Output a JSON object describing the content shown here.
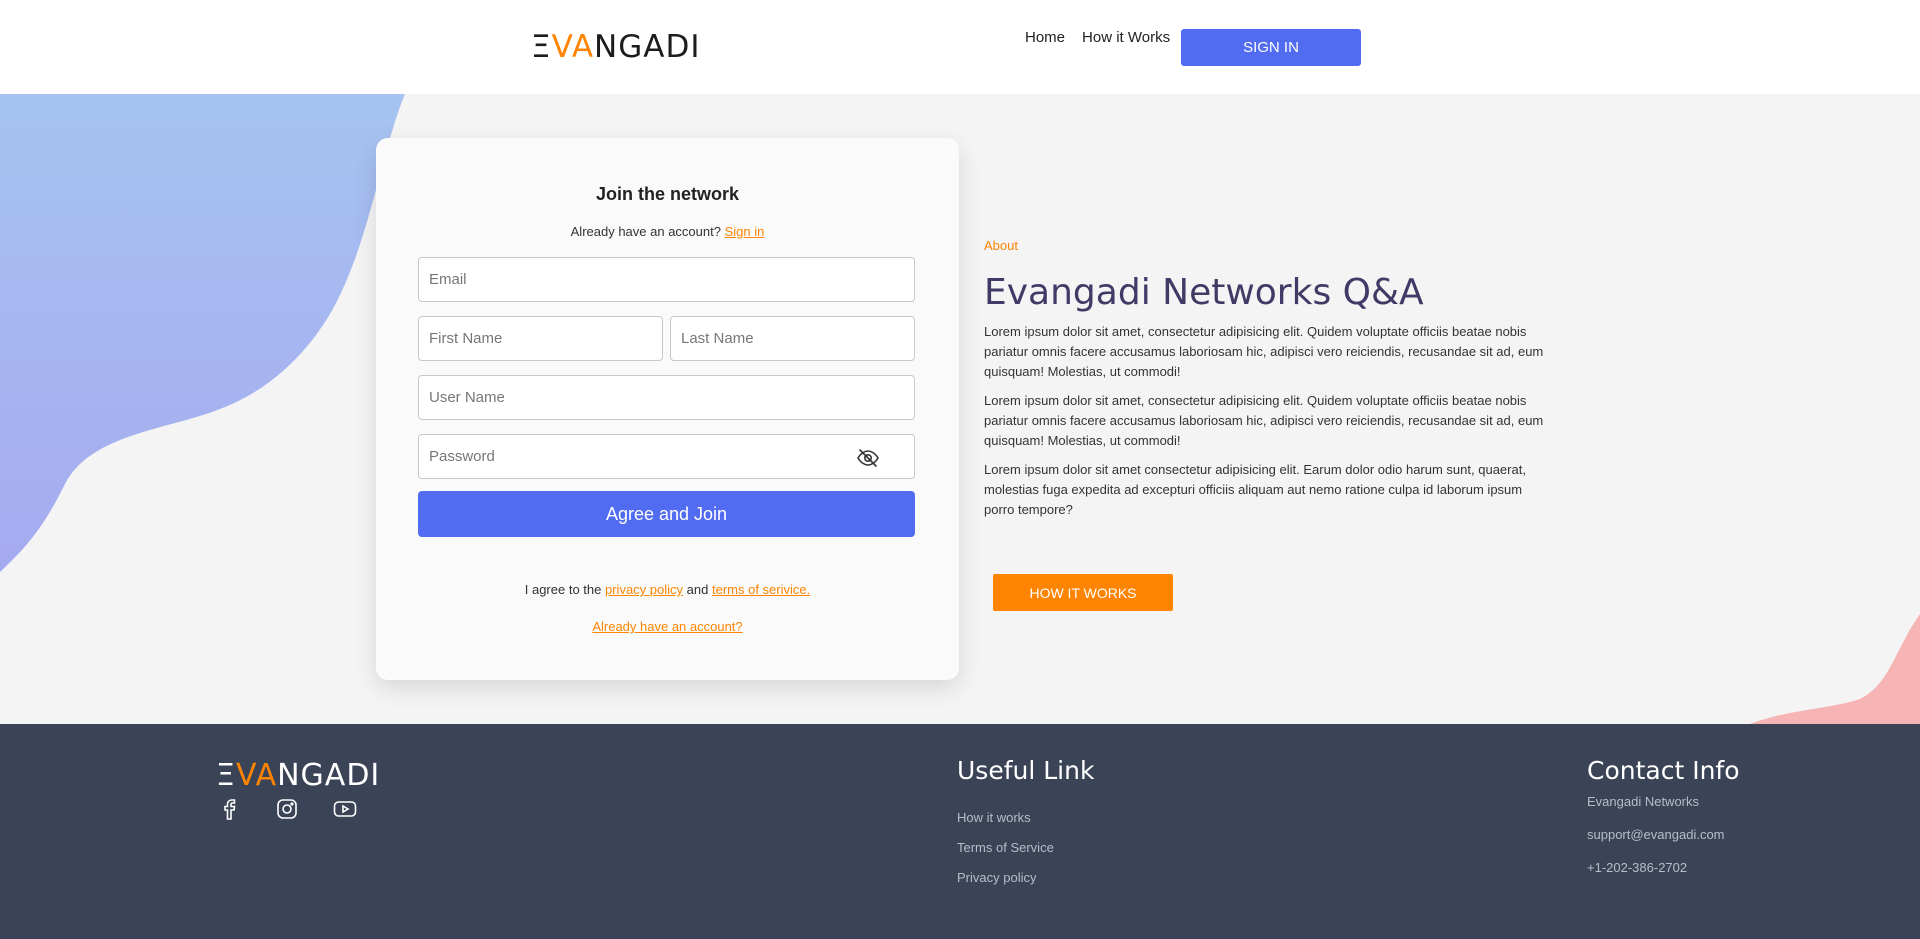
{
  "header": {
    "logo_left": "Ξ",
    "logo_accent": "VA",
    "logo_rest": "NGADI",
    "nav": [
      {
        "label": "Home"
      },
      {
        "label": "How it Works"
      }
    ],
    "signin_label": "SIGN IN"
  },
  "signup": {
    "title": "Join the network",
    "have_account_text": "Already have an account?",
    "signin_link": "Sign in",
    "email_placeholder": "Email",
    "first_name_placeholder": "First Name",
    "last_name_placeholder": "Last Name",
    "username_placeholder": "User Name",
    "password_placeholder": "Password",
    "join_button": "Agree and Join",
    "agree_prefix": "I agree to the",
    "privacy_link": "privacy policy",
    "and_text": "and",
    "terms_link": "terms of serivice.",
    "already_link": "Already have an account?"
  },
  "about": {
    "label": "About",
    "title": "Evangadi Networks Q&A",
    "paragraphs": [
      "Lorem ipsum dolor sit amet, consectetur adipisicing elit. Quidem voluptate officiis beatae nobis pariatur omnis facere accusamus laboriosam hic, adipisci vero reiciendis, recusandae sit ad, eum quisquam! Molestias, ut commodi!",
      "Lorem ipsum dolor sit amet, consectetur adipisicing elit. Quidem voluptate officiis beatae nobis pariatur omnis facere accusamus laboriosam hic, adipisci vero reiciendis, recusandae sit ad, eum quisquam! Molestias, ut commodi!",
      "Lorem ipsum dolor sit amet consectetur adipisicing elit. Earum dolor odio harum sunt, quaerat, molestias fuga expedita ad excepturi officiis aliquam aut nemo ratione culpa id laborum ipsum porro tempore?"
    ],
    "button": "HOW IT WORKS"
  },
  "footer": {
    "useful_title": "Useful Link",
    "useful_links": [
      "How it works",
      "Terms of Service",
      "Privacy policy"
    ],
    "contact_title": "Contact Info",
    "contact_lines": [
      "Evangadi Networks",
      "support@evangadi.com",
      "+1-202-386-2702"
    ],
    "social_icons": [
      "facebook-icon",
      "instagram-icon",
      "youtube-icon"
    ]
  },
  "colors": {
    "primary": "#516cf0",
    "accent": "#fe8402",
    "footer_bg": "#3b4457"
  }
}
